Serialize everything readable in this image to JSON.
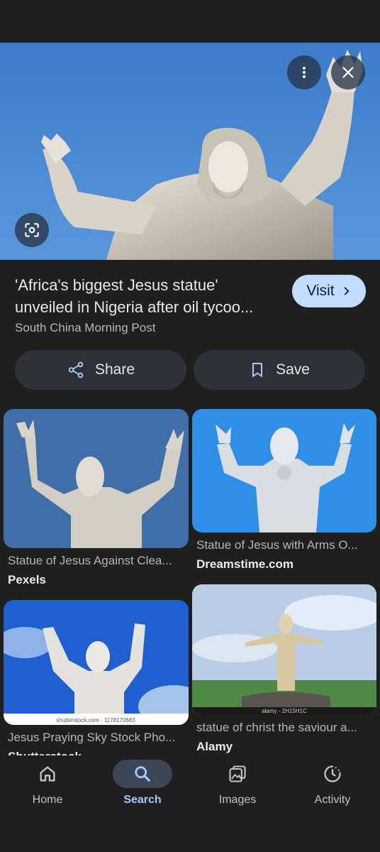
{
  "result": {
    "title_line1": "'Africa's biggest Jesus statue'",
    "title_line2": "unveiled in Nigeria after oil tycoo...",
    "source": "South China Morning Post",
    "visit_label": "Visit",
    "share_label": "Share",
    "save_label": "Save"
  },
  "related": [
    {
      "caption": "Statue of Jesus Against Clea...",
      "source": "Pexels"
    },
    {
      "caption": "Statue of Jesus with Arms O...",
      "source": "Dreamstime.com"
    },
    {
      "caption": "Jesus Praying Sky Stock Pho...",
      "source": "Shutterstock",
      "watermark": "shutterstock.com · 1178170663"
    },
    {
      "caption": "statue of christ the saviour a...",
      "source": "Alamy",
      "watermark": "alamy - 2H15H1C"
    }
  ],
  "nav": [
    {
      "label": "Home",
      "icon": "home-icon"
    },
    {
      "label": "Search",
      "icon": "search-icon",
      "active": true
    },
    {
      "label": "Images",
      "icon": "images-icon"
    },
    {
      "label": "Activity",
      "icon": "activity-icon"
    }
  ],
  "colors": {
    "background": "#1f1f1f",
    "accent": "#a8c7fa",
    "visit_button": "#c2dcff",
    "pill_button": "#2e3137"
  }
}
